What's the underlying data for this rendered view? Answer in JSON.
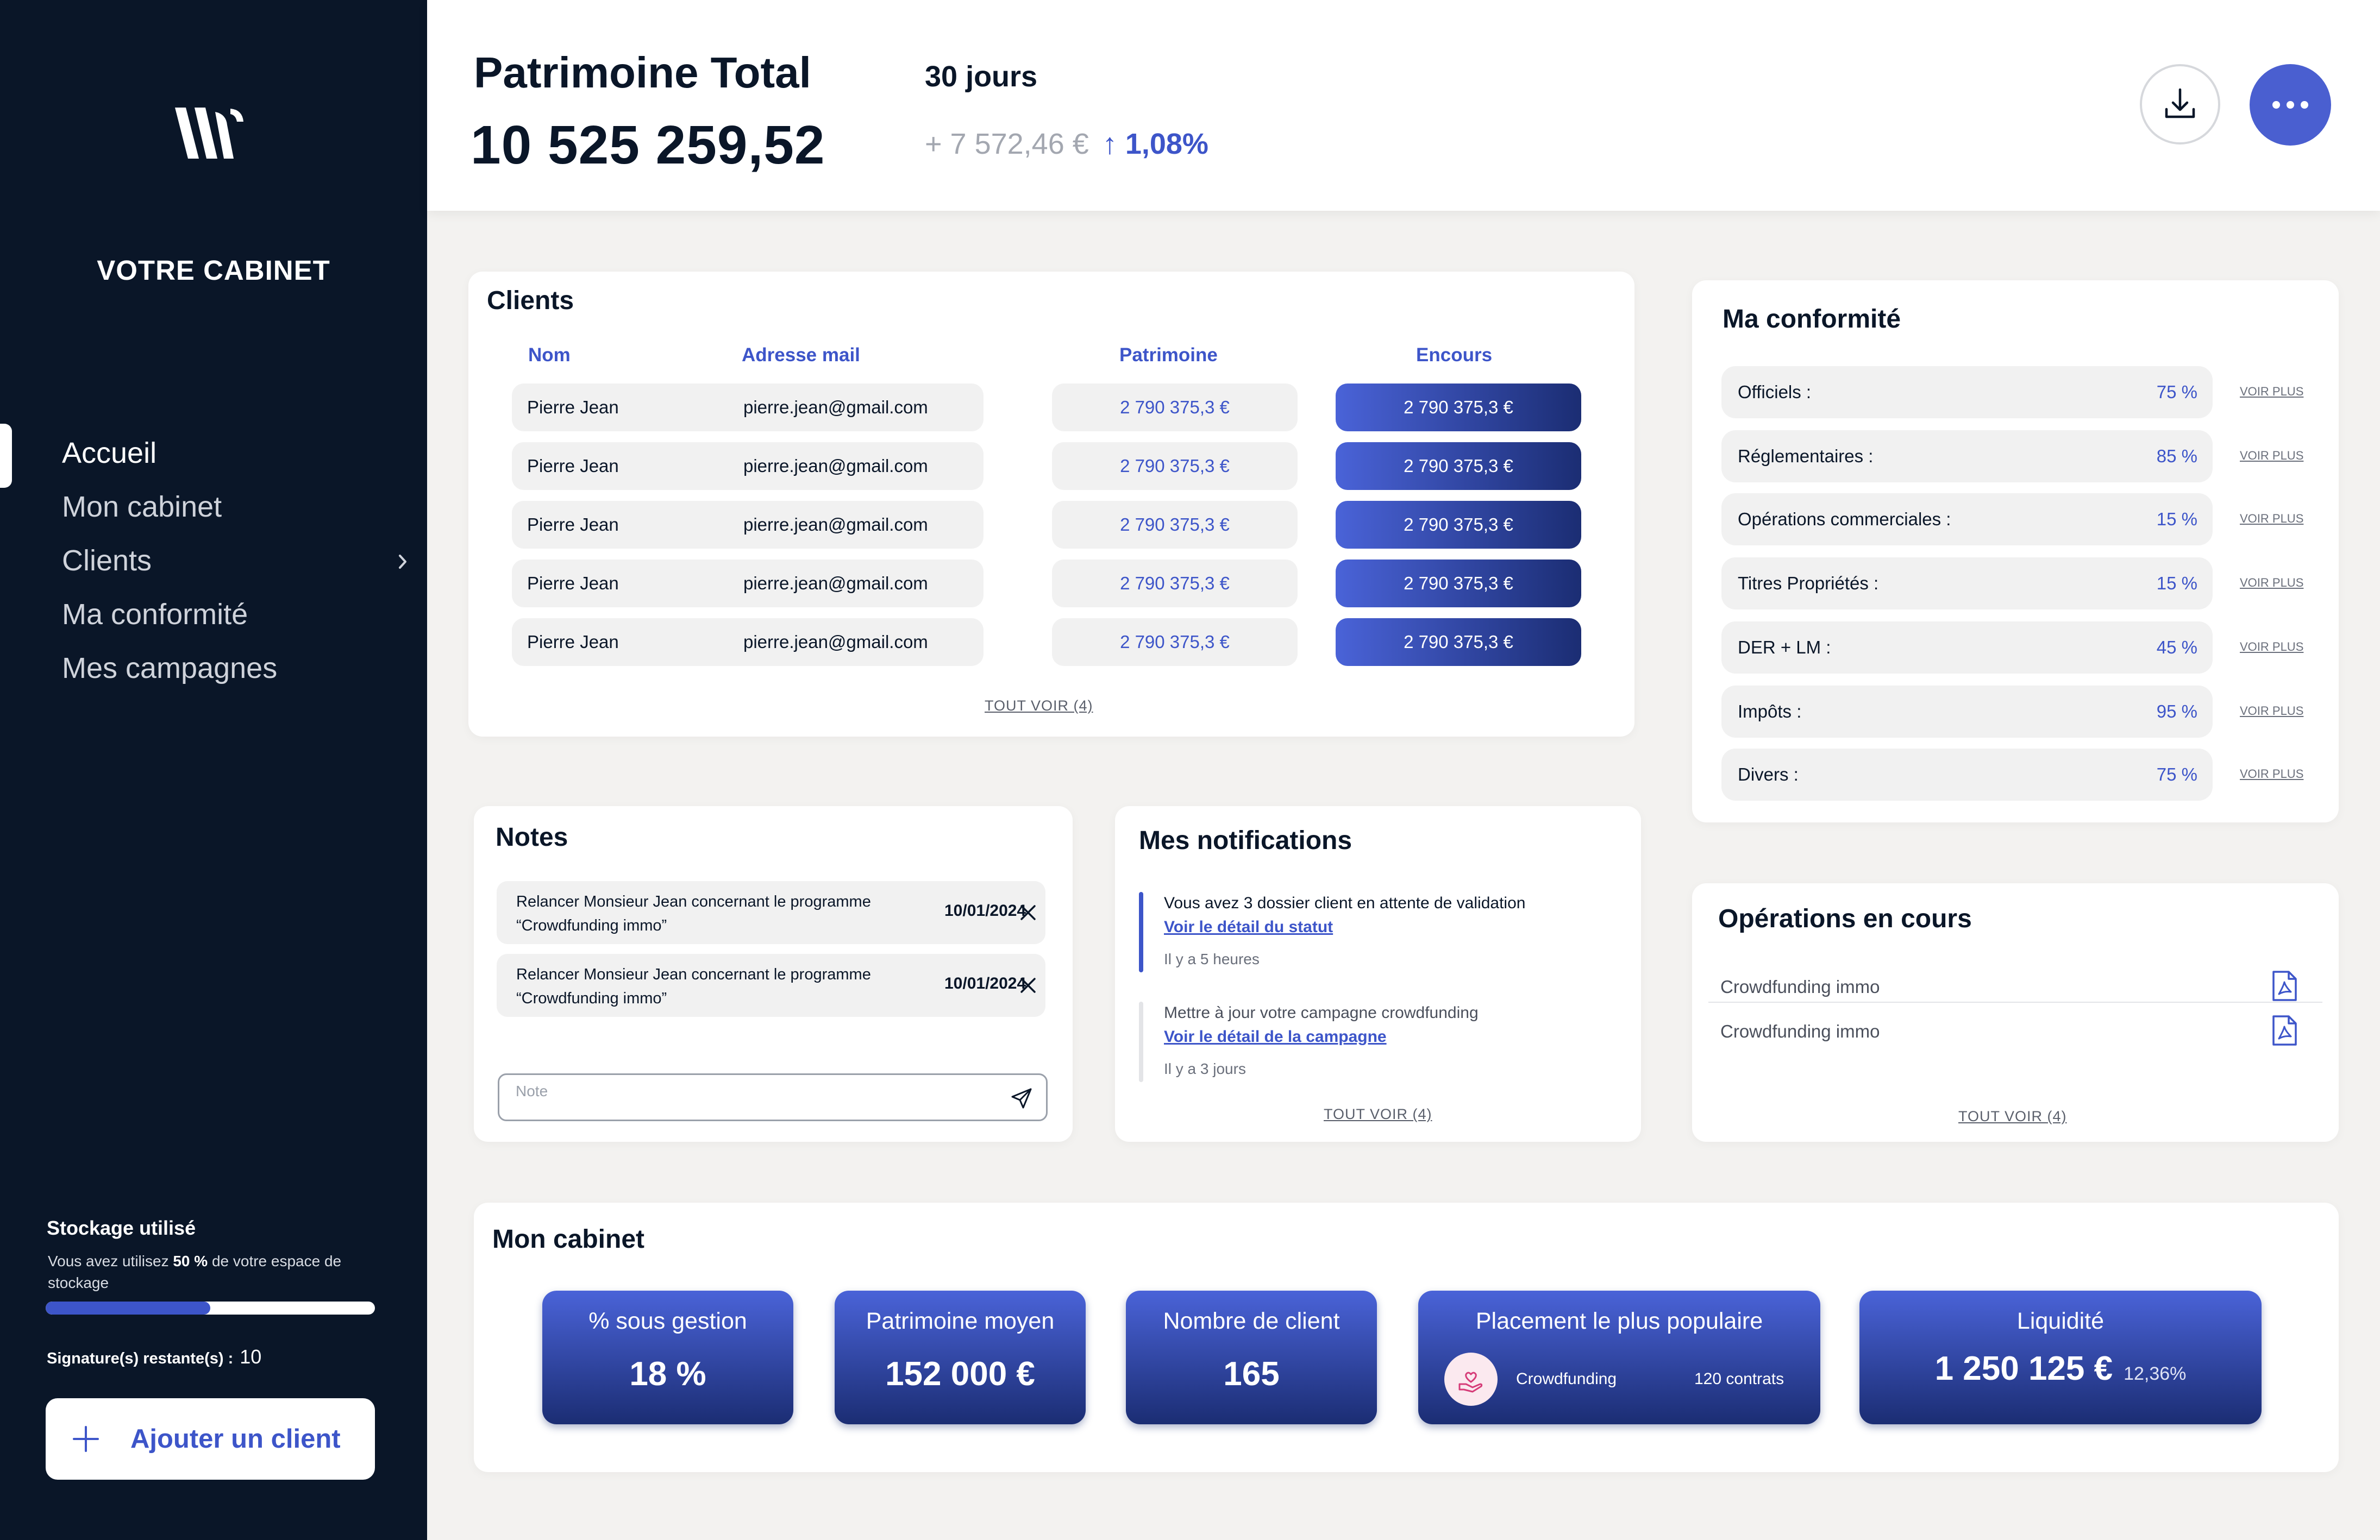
{
  "sidebar": {
    "logo": "W",
    "cabinet_title": "VOTRE CABINET",
    "nav": [
      {
        "label": "Accueil",
        "active": true
      },
      {
        "label": "Mon cabinet",
        "active": false
      },
      {
        "label": "Clients",
        "active": false,
        "has_submenu": true
      },
      {
        "label": "Ma conformité",
        "active": false
      },
      {
        "label": "Mes campagnes",
        "active": false
      }
    ],
    "storage": {
      "title": "Stockage utilisé",
      "text_before": "Vous avez utilisez ",
      "percent_label": "50 %",
      "text_after": " de votre espace de stockage",
      "used_fraction": 0.5
    },
    "signatures": {
      "label": "Signature(s) restante(s) :",
      "count": "10"
    },
    "add_client_label": "Ajouter un client"
  },
  "header": {
    "title": "Patrimoine Total",
    "total": "10 525 259,52",
    "period": "30 jours",
    "change_amount": "+ 7 572,46 €",
    "change_arrow": "↑",
    "change_percent": "1,08%"
  },
  "clients": {
    "title": "Clients",
    "columns": {
      "name": "Nom",
      "email": "Adresse mail",
      "patrimoine": "Patrimoine",
      "encours": "Encours"
    },
    "rows": [
      {
        "name": "Pierre Jean",
        "email": "pierre.jean@gmail.com",
        "patrimoine": "2 790 375,3 €",
        "encours": "2 790 375,3 €"
      },
      {
        "name": "Pierre Jean",
        "email": "pierre.jean@gmail.com",
        "patrimoine": "2 790 375,3 €",
        "encours": "2 790 375,3 €"
      },
      {
        "name": "Pierre Jean",
        "email": "pierre.jean@gmail.com",
        "patrimoine": "2 790 375,3 €",
        "encours": "2 790 375,3 €"
      },
      {
        "name": "Pierre Jean",
        "email": "pierre.jean@gmail.com",
        "patrimoine": "2 790 375,3 €",
        "encours": "2 790 375,3 €"
      },
      {
        "name": "Pierre Jean",
        "email": "pierre.jean@gmail.com",
        "patrimoine": "2 790 375,3 €",
        "encours": "2 790 375,3 €"
      }
    ],
    "see_all": "TOUT VOIR (4)"
  },
  "conformite": {
    "title": "Ma conformité",
    "voir_plus": "VOIR PLUS",
    "items": [
      {
        "label": "Officiels :",
        "value": "75 %"
      },
      {
        "label": "Réglementaires :",
        "value": "85 %"
      },
      {
        "label": "Opérations commerciales :",
        "value": "15 %"
      },
      {
        "label": "Titres Propriétés :",
        "value": "15 %"
      },
      {
        "label": "DER + LM :",
        "value": "45 %"
      },
      {
        "label": "Impôts :",
        "value": "95 %"
      },
      {
        "label": "Divers :",
        "value": "75 %"
      }
    ]
  },
  "notes": {
    "title": "Notes",
    "items": [
      {
        "text": "Relancer Monsieur Jean concernant le programme “Crowdfunding immo”",
        "date": "10/01/2024"
      },
      {
        "text": "Relancer Monsieur Jean concernant le programme “Crowdfunding immo”",
        "date": "10/01/2024"
      }
    ],
    "input_placeholder": "Note"
  },
  "notifications": {
    "title": "Mes notifications",
    "items": [
      {
        "text": "Vous avez 3 dossier client en attente de validation",
        "link": "Voir le détail du statut",
        "ago": "Il y a 5 heures",
        "unread": true
      },
      {
        "text": "Mettre à jour votre campagne crowdfunding",
        "link": "Voir le détail de la campagne",
        "ago": "Il y a 3 jours",
        "unread": false
      }
    ],
    "see_all": "TOUT VOIR (4)"
  },
  "operations": {
    "title": "Opérations en cours",
    "items": [
      {
        "label": "Crowdfunding immo",
        "icon": "pdf-icon"
      },
      {
        "label": "Crowdfunding immo",
        "icon": "pdf-icon"
      }
    ],
    "see_all": "TOUT VOIR (4)"
  },
  "cabinet": {
    "title": "Mon cabinet",
    "tiles": {
      "gestion": {
        "title": "% sous gestion",
        "value": "18 %"
      },
      "patrimoine": {
        "title": "Patrimoine moyen",
        "value": "152 000 €"
      },
      "clients": {
        "title": "Nombre de client",
        "value": "165"
      },
      "populaire": {
        "title": "Placement le plus populaire",
        "name": "Crowdfunding",
        "count": "120 contrats"
      },
      "liquidite": {
        "title": "Liquidité",
        "value": "1 250 125 €",
        "percent": "12,36%"
      }
    }
  },
  "colors": {
    "sidebar_bg": "#0a1628",
    "accent": "#3d55c9",
    "gradient_start": "#4a63d8",
    "gradient_end": "#1b2d73",
    "page_bg": "#f3f2f0"
  }
}
